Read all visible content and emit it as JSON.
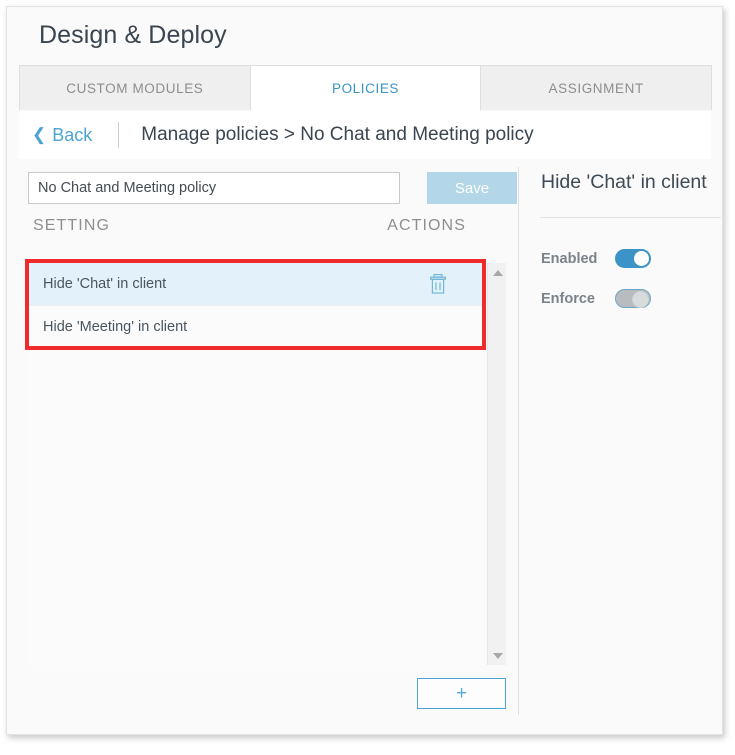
{
  "window": {
    "title": "Design & Deploy"
  },
  "tabs": [
    {
      "label": "CUSTOM MODULES",
      "active": false
    },
    {
      "label": "POLICIES",
      "active": true
    },
    {
      "label": "ASSIGNMENT",
      "active": false
    }
  ],
  "breadcrumb": {
    "back_label": "Back",
    "back_icon": "chevron-left-icon",
    "path": "Manage policies > No Chat and Meeting policy"
  },
  "editor": {
    "policy_name_value": "No Chat and Meeting policy",
    "policy_name_placeholder": "Policy name",
    "save_label": "Save",
    "save_disabled": true,
    "columns": {
      "setting": "SETTING",
      "actions": "ACTIONS"
    },
    "rows": [
      {
        "label": "Hide 'Chat' in client",
        "selected": true,
        "action_icon": "trash-icon"
      },
      {
        "label": "Hide 'Meeting' in client",
        "selected": false,
        "action_icon": ""
      }
    ],
    "add_label": "+",
    "scrollbar": {
      "up_icon": "caret-up-icon",
      "down_icon": "caret-down-icon"
    }
  },
  "detail": {
    "title": "Hide 'Chat' in client",
    "toggles": [
      {
        "label": "Enabled",
        "state": "on"
      },
      {
        "label": "Enforce",
        "state": "off"
      }
    ]
  },
  "colors": {
    "accent_blue": "#3b93c6",
    "link_blue": "#4ba3d3",
    "selected_row": "#e3f1fa",
    "highlight_red": "#ef2b2b",
    "save_disabled": "#b3d7e8",
    "text_dark": "#3a4550",
    "text_muted": "#8e8e8e"
  }
}
